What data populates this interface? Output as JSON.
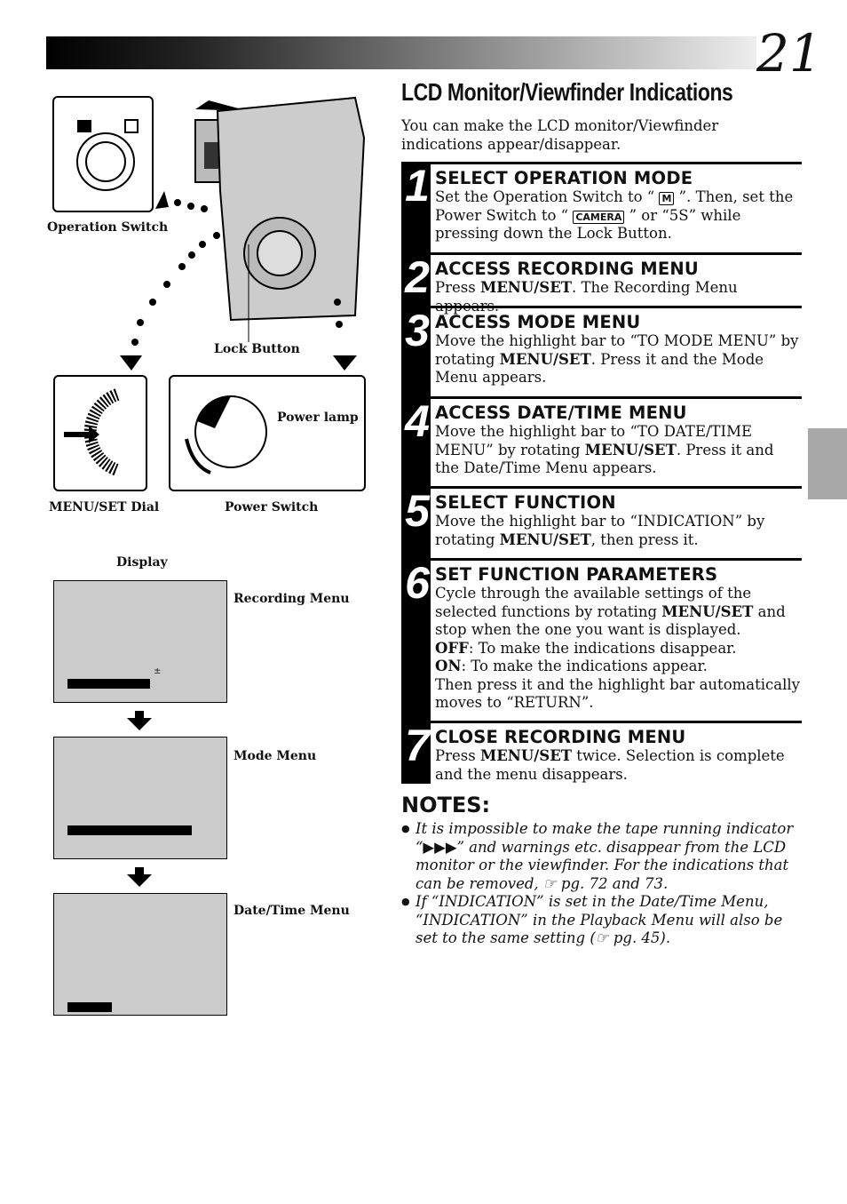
{
  "page_number": "21",
  "title": "LCD Monitor/Viewfinder Indications",
  "intro": "You can make the LCD monitor/Viewfinder indications appear/disappear.",
  "figure_labels": {
    "operation_switch": "Operation Switch",
    "lock_button": "Lock Button",
    "menu_set_dial": "MENU/SET Dial",
    "power_switch": "Power Switch",
    "power_lamp": "Power lamp",
    "display": "Display",
    "recording_menu": "Recording Menu",
    "mode_menu": "Mode Menu",
    "date_time_menu": "Date/Time Menu",
    "mode_icon": "M",
    "camera_icon": "CAMERA",
    "plus_minus": "±"
  },
  "steps": [
    {
      "num": "1",
      "heading": "SELECT OPERATION MODE",
      "body_a": "Set the Operation Switch to “ ",
      "body_b": " ”. Then, set the Power Switch to “ ",
      "body_c": " ” or “5S” while pressing down the Lock Button."
    },
    {
      "num": "2",
      "heading": "ACCESS RECORDING MENU",
      "pre": "Press ",
      "bold": "MENU/SET",
      "post": ". The Recording Menu appears."
    },
    {
      "num": "3",
      "heading": "ACCESS MODE MENU",
      "pre": "Move the highlight bar to “TO MODE MENU” by rotating ",
      "bold": "MENU/SET",
      "post": ". Press it and the Mode Menu appears."
    },
    {
      "num": "4",
      "heading": "ACCESS DATE/TIME MENU",
      "pre": "Move the highlight bar to “TO DATE/TIME MENU” by rotating ",
      "bold": "MENU/SET",
      "post": ". Press it and the Date/Time Menu appears."
    },
    {
      "num": "5",
      "heading": "SELECT FUNCTION",
      "pre": "Move the highlight bar to “INDICATION” by rotating ",
      "bold": "MENU/SET",
      "post": ", then press it."
    },
    {
      "num": "6",
      "heading": "SET FUNCTION PARAMETERS",
      "pre": "Cycle through the available settings of the selected functions by rotating ",
      "bold": "MENU/SET",
      "post": " and stop when the one you want is displayed.",
      "off_b": "OFF",
      "off": ": To make the indications disappear.",
      "on_b": "ON",
      "on": ": To make the indications appear.",
      "tail": "Then press it and the highlight bar automatically moves to “RETURN”."
    },
    {
      "num": "7",
      "heading": "CLOSE RECORDING MENU",
      "pre": "Press ",
      "bold": "MENU/SET",
      "post": " twice. Selection is complete and the menu disappears."
    }
  ],
  "notes": {
    "heading": "NOTES:",
    "items": [
      "It is impossible to make the tape running indicator “▶▶▶” and warnings etc. disappear from the LCD monitor or the viewfinder. For the indications that can be removed, ☞ pg. 72 and 73.",
      "If “INDICATION” is set in the Date/Time Menu, “INDICATION” in the Playback Menu will also be set to the same setting (☞ pg. 45)."
    ]
  }
}
